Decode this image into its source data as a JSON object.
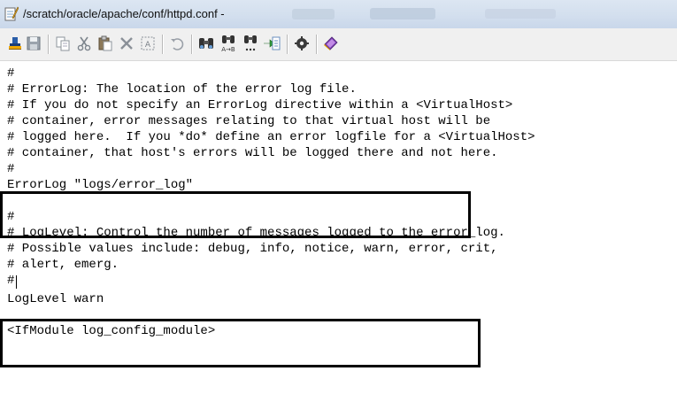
{
  "window": {
    "title": "/scratch/oracle/apache/conf/httpd.conf - "
  },
  "toolbar": {
    "buttons": [
      {
        "name": "run-icon"
      },
      {
        "name": "save-icon"
      },
      {
        "name": "copy-icon"
      },
      {
        "name": "cut-icon"
      },
      {
        "name": "paste-icon"
      },
      {
        "name": "delete-icon"
      },
      {
        "name": "select-all-icon"
      },
      {
        "name": "undo-icon"
      },
      {
        "name": "find-icon"
      },
      {
        "name": "replace-icon"
      },
      {
        "name": "find-in-files-icon"
      },
      {
        "name": "goto-icon"
      },
      {
        "name": "settings-icon"
      },
      {
        "name": "help-icon"
      }
    ]
  },
  "editor": {
    "lines": [
      "#",
      "# ErrorLog: The location of the error log file.",
      "# If you do not specify an ErrorLog directive within a <VirtualHost>",
      "# container, error messages relating to that virtual host will be",
      "# logged here.  If you *do* define an error logfile for a <VirtualHost>",
      "# container, that host's errors will be logged there and not here.",
      "#",
      "ErrorLog \"logs/error_log\"",
      "",
      "#",
      "# LogLevel: Control the number of messages logged to the error_log.",
      "# Possible values include: debug, info, notice, warn, error, crit,",
      "# alert, emerg.",
      "#",
      "LogLevel warn",
      "",
      "<IfModule log_config_module>"
    ]
  },
  "colors": {
    "highlight_border": "#000000",
    "titlebar": "#d3dfee",
    "toolbar": "#f0f0f0",
    "text": "#000000"
  }
}
